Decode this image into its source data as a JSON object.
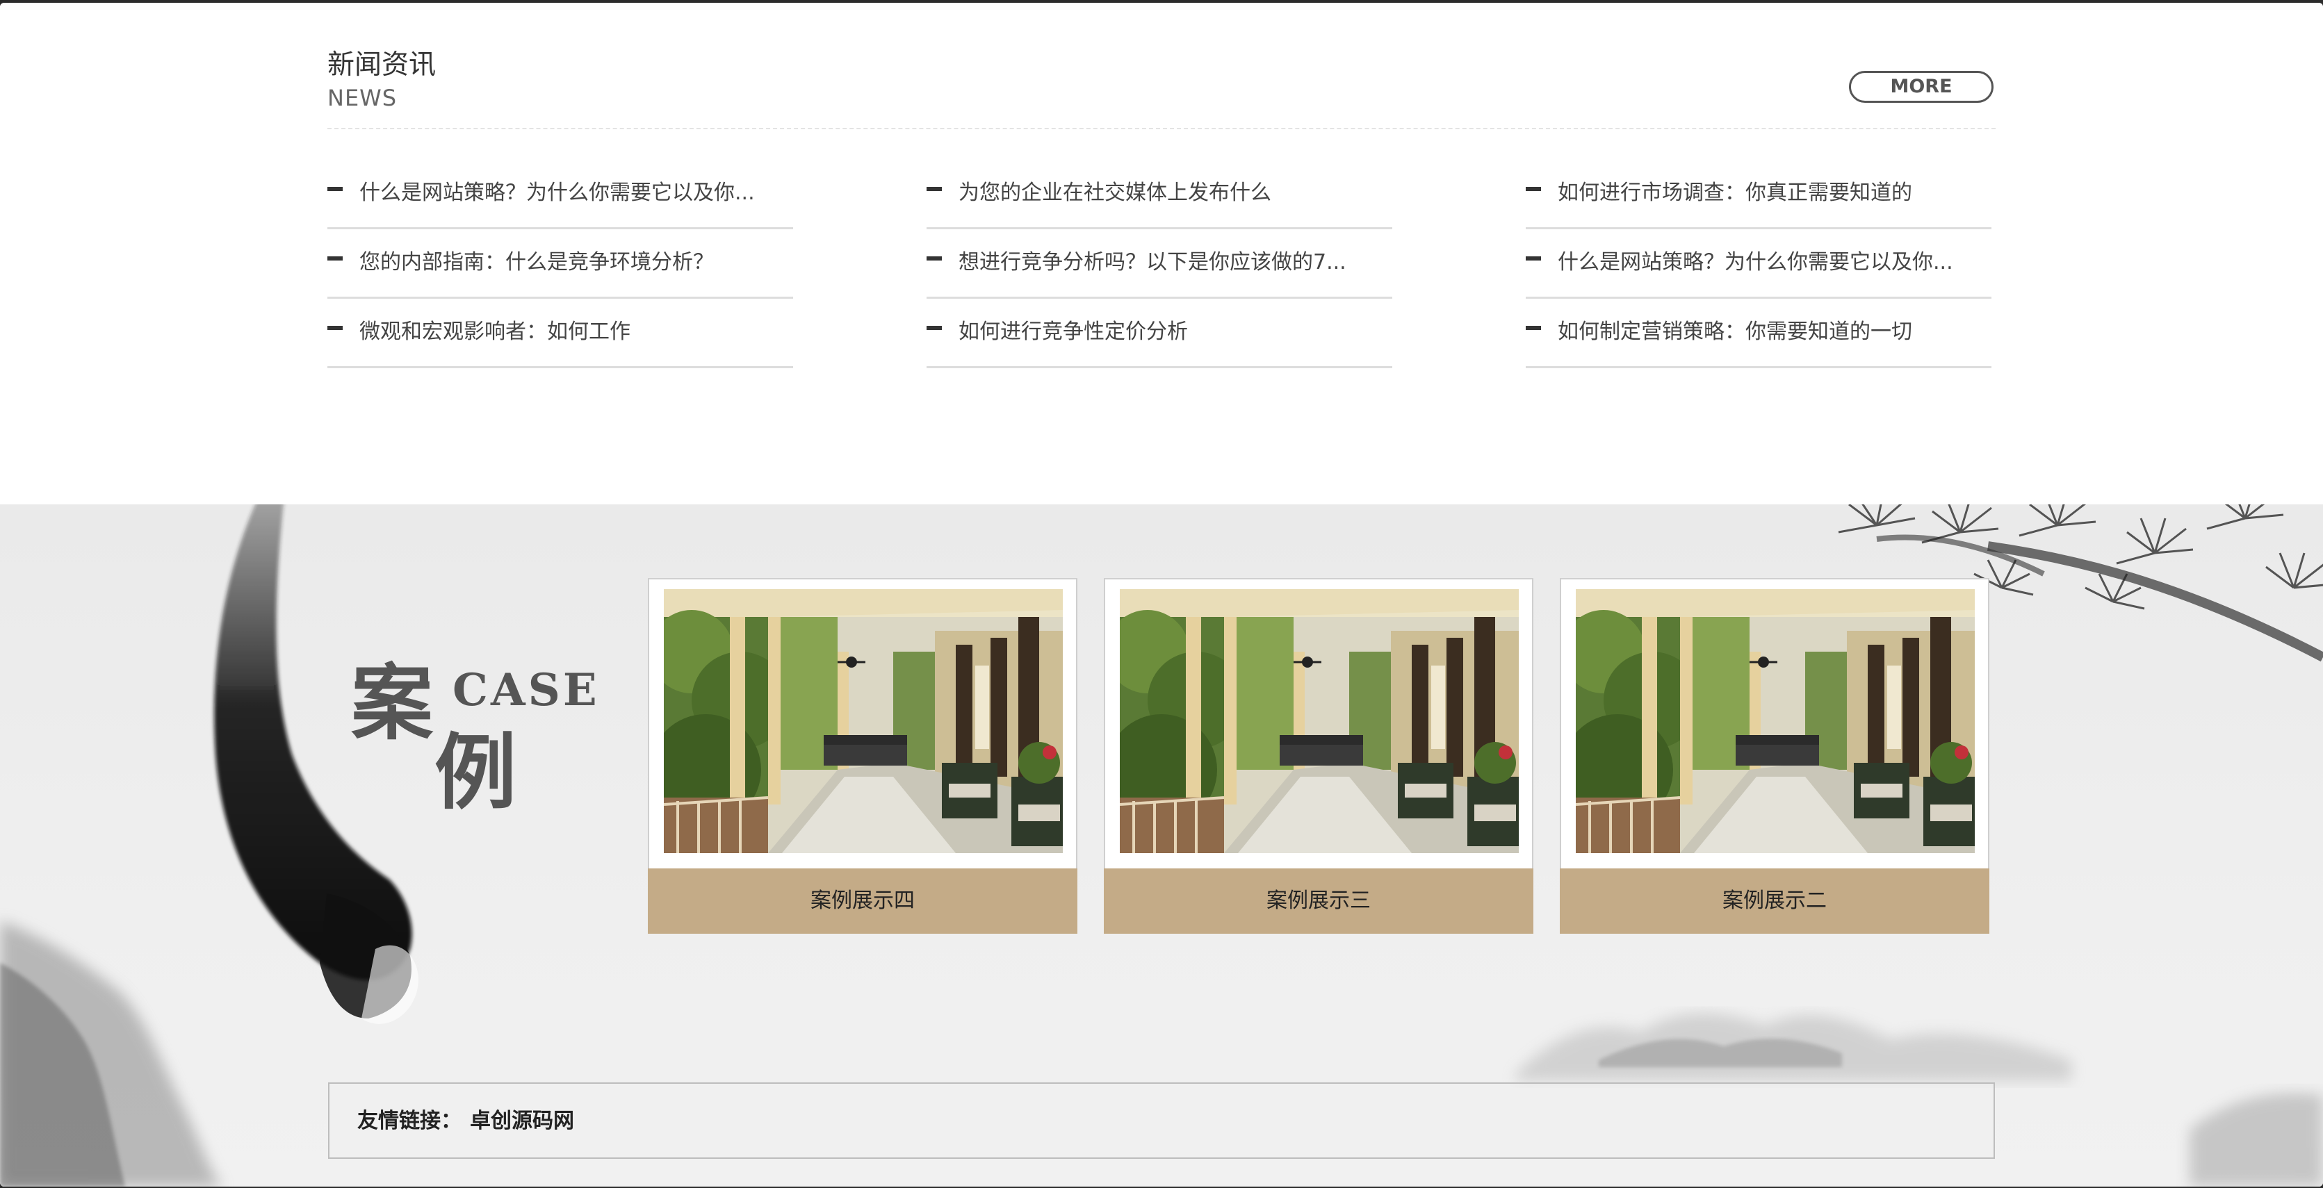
{
  "news": {
    "title": "新闻资讯",
    "subtitle": "NEWS",
    "more_label": "MORE",
    "columns": [
      {
        "items": [
          {
            "title": "什么是网站策略？为什么你需要它以及你..."
          },
          {
            "title": "您的内部指南：什么是竞争环境分析？"
          },
          {
            "title": "微观和宏观影响者：如何工作"
          }
        ]
      },
      {
        "items": [
          {
            "title": "为您的企业在社交媒体上发布什么"
          },
          {
            "title": "想进行竞争分析吗？以下是你应该做的7..."
          },
          {
            "title": "如何进行竞争性定价分析"
          }
        ]
      },
      {
        "items": [
          {
            "title": "如何进行市场调查：你真正需要知道的"
          },
          {
            "title": "什么是网站策略？为什么你需要它以及你..."
          },
          {
            "title": "如何制定营销策略：你需要知道的一切"
          }
        ]
      }
    ]
  },
  "case": {
    "title_char_1": "案",
    "title_char_2": "例",
    "title_en": "CASE",
    "cards": [
      {
        "caption": "案例展示四"
      },
      {
        "caption": "案例展示三"
      },
      {
        "caption": "案例展示二"
      }
    ]
  },
  "links": {
    "label": "友情链接：",
    "items": [
      {
        "label": "卓创源码网"
      }
    ]
  },
  "colors": {
    "caption_bg": "#c4ab87",
    "case_bg": "#ececec",
    "text_dark": "#333333"
  }
}
